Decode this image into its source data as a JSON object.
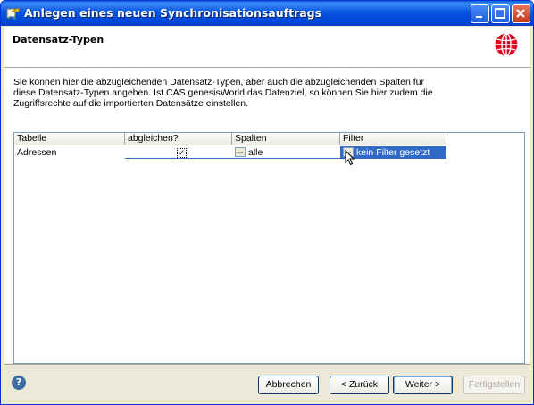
{
  "window": {
    "title": "Anlegen eines neuen Synchronisationsauftrags"
  },
  "header": {
    "title": "Datensatz-Typen"
  },
  "description": [
    "Sie können hier die abzugleichenden Datensatz-Typen, aber auch die abzugleichenden Spalten für",
    "diese Datensatz-Typen angeben. Ist CAS genesisWorld das Datenziel, so können Sie hier zudem die",
    "Zugriffsrechte auf die importierten Datensätze einstellen."
  ],
  "grid": {
    "columns": [
      "Tabelle",
      "abgleichen?",
      "Spalten",
      "Filter"
    ],
    "rows": [
      {
        "tabelle": "Adressen",
        "abgleichen": "✓",
        "spalten": "alle",
        "filter": "kein Filter gesetzt"
      }
    ]
  },
  "ellipsis": "...",
  "buttons": {
    "help": "?",
    "cancel": "Abbrechen",
    "back": "< Zurück",
    "next": "Weiter >",
    "finish": "Fertigstellen"
  },
  "colors": {
    "titlebar": "#0054e3",
    "selection": "#316ac5",
    "dialog_bg": "#ece9d8"
  }
}
